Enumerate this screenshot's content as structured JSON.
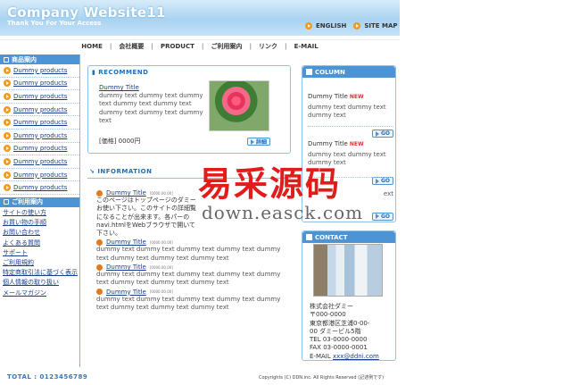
{
  "header": {
    "title": "Company Website11",
    "subtitle": "Thank You For Your Access",
    "links": [
      "ENGLISH",
      "SITE MAP"
    ]
  },
  "nav": {
    "items": [
      "HOME",
      "会社概要",
      "PRODUCT",
      "ご利用案内",
      "リンク",
      "E-MAIL"
    ]
  },
  "sidebar": {
    "products_title": "商品案内",
    "products": [
      "Dummy products",
      "Dummy products",
      "Dummy products",
      "Dummy products",
      "Dummy products",
      "Dummy products",
      "Dummy products",
      "Dummy products",
      "Dummy products",
      "Dummy products"
    ],
    "guide_title": "ご利用案内",
    "guide_items": [
      "サイトの使い方",
      "お買い物の手順",
      "お問い合わせ",
      "よくある質問",
      "サポート",
      "ご利用規約",
      "特定商取引法に基づく表示",
      "個人情報の取り扱い",
      "メールマガジン"
    ]
  },
  "recommend": {
    "title": "RECOMMEND",
    "item_title": "Dummy Title",
    "text": "dummy text dummy text dummy text dummy text dummy text dummy text dummy text dummy text",
    "price": "[価格]  0000円",
    "button": "詳細"
  },
  "information": {
    "title": "INFORMATION",
    "items": [
      {
        "title": "Dummy Title",
        "date": "[0000.00.00]",
        "text": "このページはトップページのダミーお使い下さい。このサイトの詳細覧になることが出来ます。各パーのnavi.htmlをWebブラウザで開いて下さい。"
      },
      {
        "title": "Dummy Title",
        "date": "[0000.00.00]",
        "text": "dummy text dummy text dummy text dummy text dummy text dummy text dummy text dummy text"
      },
      {
        "title": "Dummy Title",
        "date": "[0000.00.00]",
        "text": "dummy text dummy text dummy text dummy text dummy text dummy text dummy text dummy text"
      },
      {
        "title": "Dummy Title",
        "date": "[0000.00.00]",
        "text": "dummy text dummy text dummy text dummy text dummy text dummy text dummy text dummy text"
      }
    ]
  },
  "column": {
    "title": "COLUMN",
    "items": [
      {
        "title": "Dummy Title",
        "badge": "NEW",
        "text": "dummy text dummy text dummy text",
        "button": "GO"
      },
      {
        "title": "Dummy Title",
        "badge": "NEW",
        "text": "dummy text dummy text dummy text",
        "button": "GO"
      },
      {
        "text": "ext",
        "button": "GO"
      }
    ]
  },
  "contact": {
    "title": "CONTACT",
    "lines": [
      "株式会社ダミー",
      "〒000-0000",
      "東京都港区芝浦0-00-",
      "00 ダミービル5階",
      "TEL 03-0000-0000",
      "FAX 03-0000-0001"
    ],
    "email_label": "E-MAIL",
    "email": "xxx@ddni.com"
  },
  "footer": {
    "total": "TOTAL : 0123456789",
    "copyright": "Copyrights (C) DDN.inc. All Rights Reserved (記述例です)"
  },
  "watermark": {
    "cn": "易采源码",
    "url": "down.easck.com"
  },
  "colors": {
    "accent": "#4d94d4",
    "bullet": "#e27a1f",
    "badge": "#e03030",
    "watermark": "#e21b1b"
  }
}
